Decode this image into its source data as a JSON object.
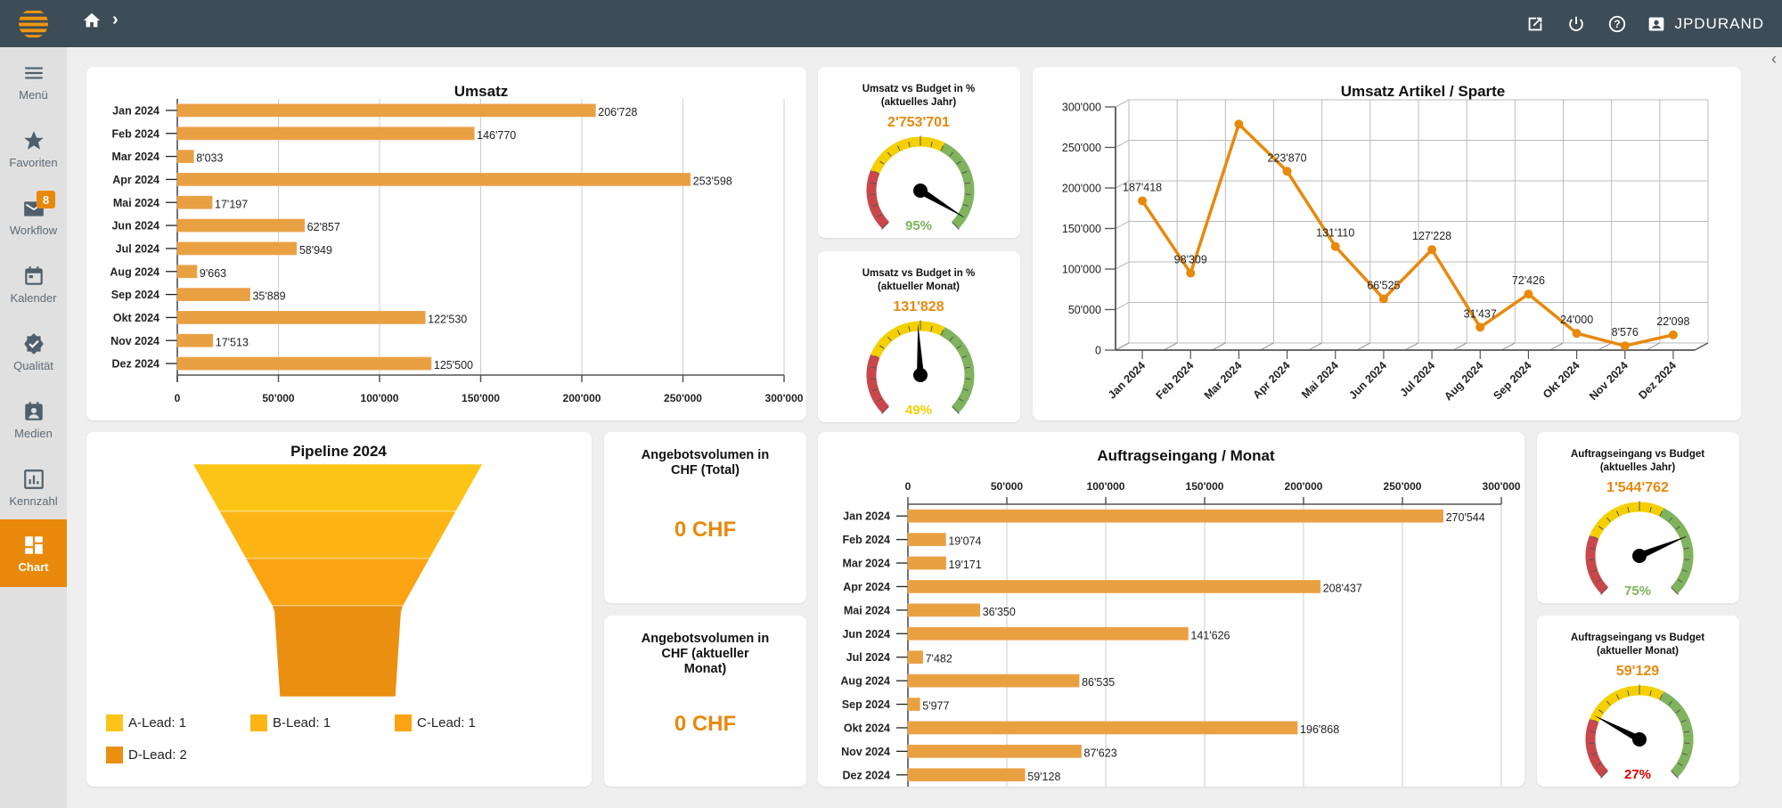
{
  "topbar": {
    "user": "JPDURAND",
    "icons": [
      "logo-icon",
      "home-icon",
      "chevron-right-icon",
      "open-external-icon",
      "power-icon",
      "help-icon",
      "user-icon"
    ]
  },
  "sidebar": {
    "items": [
      {
        "label": "Menü",
        "icon": "menu-icon"
      },
      {
        "label": "Favoriten",
        "icon": "star-icon"
      },
      {
        "label": "Workflow",
        "icon": "mail-icon",
        "badge": "8"
      },
      {
        "label": "Kalender",
        "icon": "calendar-icon"
      },
      {
        "label": "Qualität",
        "icon": "verified-icon"
      },
      {
        "label": "Medien",
        "icon": "media-icon"
      },
      {
        "label": "Kennzahl",
        "icon": "bar-chart-icon"
      },
      {
        "label": "Chart",
        "icon": "dashboard-icon",
        "active": true
      }
    ]
  },
  "colors": {
    "accent": "#e8890c",
    "bar": "#e9a040",
    "red": "#c9474a",
    "yellow": "#f5d000",
    "green": "#7fb35d",
    "topbar": "#3d4c56"
  },
  "gauges": [
    {
      "title_l1": "Umsatz vs Budget in %",
      "title_l2": "(aktuelles Jahr)",
      "value": "2'753'701",
      "percent": 95,
      "percent_label": "95%",
      "percent_color": "#7fb35d"
    },
    {
      "title_l1": "Umsatz vs Budget in %",
      "title_l2": "(aktueller Monat)",
      "value": "131'828",
      "percent": 49,
      "percent_label": "49%",
      "percent_color": "#f5d000"
    },
    {
      "title_l1": "Auftragseingang vs Budget",
      "title_l2": "(aktuelles Jahr)",
      "value": "1'544'762",
      "percent": 75,
      "percent_label": "75%",
      "percent_color": "#7fb35d"
    },
    {
      "title_l1": "Auftragseingang vs Budget",
      "title_l2": "(aktueller Monat)",
      "value": "59'129",
      "percent": 27,
      "percent_label": "27%",
      "percent_color": "#e00000"
    }
  ],
  "kpis": [
    {
      "title_l1": "Angebotsvolumen in",
      "title_l2": "CHF (Total)",
      "title_l3": "",
      "value": "0 CHF"
    },
    {
      "title_l1": "Angebotsvolumen in",
      "title_l2": "CHF (aktueller",
      "title_l3": "Monat)",
      "value": "0 CHF"
    }
  ],
  "chart_data": [
    {
      "type": "bar",
      "orientation": "horizontal",
      "title": "Umsatz",
      "categories": [
        "Jan 2024",
        "Feb 2024",
        "Mar 2024",
        "Apr 2024",
        "Mai 2024",
        "Jun 2024",
        "Jul 2024",
        "Aug 2024",
        "Sep 2024",
        "Okt 2024",
        "Nov 2024",
        "Dez 2024"
      ],
      "values": [
        206728,
        146770,
        8033,
        253598,
        17197,
        62857,
        58949,
        9663,
        35889,
        122530,
        17513,
        125500
      ],
      "labels": [
        "206'728",
        "146'770",
        "8'033",
        "253'598",
        "17'197",
        "62'857",
        "58'949",
        "9'663",
        "35'889",
        "122'530",
        "17'513",
        "125'500"
      ],
      "xticks": [
        "0",
        "50'000",
        "100'000",
        "150'000",
        "200'000",
        "250'000",
        "300'000"
      ],
      "xlim": [
        0,
        300000
      ],
      "grid": true,
      "axis_position": "bottom"
    },
    {
      "type": "line",
      "title": "Umsatz Artikel / Sparte",
      "categories": [
        "Jan 2024",
        "Feb 2024",
        "Mar 2024",
        "Apr 2024",
        "Mai 2024",
        "Jun 2024",
        "Jul 2024",
        "Aug 2024",
        "Sep 2024",
        "Okt 2024",
        "Nov 2024",
        "Dez 2024"
      ],
      "values": [
        187418,
        98309,
        282000,
        223870,
        131110,
        66525,
        127228,
        31437,
        72426,
        24000,
        8576,
        22098
      ],
      "labels": [
        "187'418",
        "98'309",
        "",
        "223'870",
        "131'110",
        "66'525",
        "127'228",
        "31'437",
        "72'426",
        "24'000",
        "8'576",
        "22'098"
      ],
      "yticks": [
        "0",
        "50'000",
        "100'000",
        "150'000",
        "200'000",
        "250'000",
        "300'000"
      ],
      "ylim": [
        0,
        300000
      ],
      "grid": true,
      "style": "3d"
    },
    {
      "type": "funnel",
      "title": "Pipeline 2024",
      "categories": [
        "A-Lead",
        "B-Lead",
        "C-Lead",
        "D-Lead"
      ],
      "values": [
        1,
        1,
        1,
        2
      ],
      "legend": [
        "A-Lead:  1",
        "B-Lead:  1",
        "C-Lead:  1",
        "D-Lead:  2"
      ],
      "colors": [
        "#fdc418",
        "#fdb515",
        "#fca313",
        "#ea8f10"
      ],
      "legend_position": "bottom"
    },
    {
      "type": "bar",
      "orientation": "horizontal",
      "title": "Auftragseingang / Monat",
      "categories": [
        "Jan 2024",
        "Feb 2024",
        "Mar 2024",
        "Apr 2024",
        "Mai 2024",
        "Jun 2024",
        "Jul 2024",
        "Aug 2024",
        "Sep 2024",
        "Okt 2024",
        "Nov 2024",
        "Dez 2024"
      ],
      "values": [
        270544,
        19074,
        19171,
        208437,
        36350,
        141626,
        7482,
        86535,
        5977,
        196868,
        87623,
        59128
      ],
      "labels": [
        "270'544",
        "19'074",
        "19'171",
        "208'437",
        "36'350",
        "141'626",
        "7'482",
        "86'535",
        "5'977",
        "196'868",
        "87'623",
        "59'128"
      ],
      "xticks": [
        "0",
        "50'000",
        "100'000",
        "150'000",
        "200'000",
        "250'000",
        "300'000"
      ],
      "xlim": [
        0,
        300000
      ],
      "grid": true,
      "axis_position": "top"
    }
  ]
}
